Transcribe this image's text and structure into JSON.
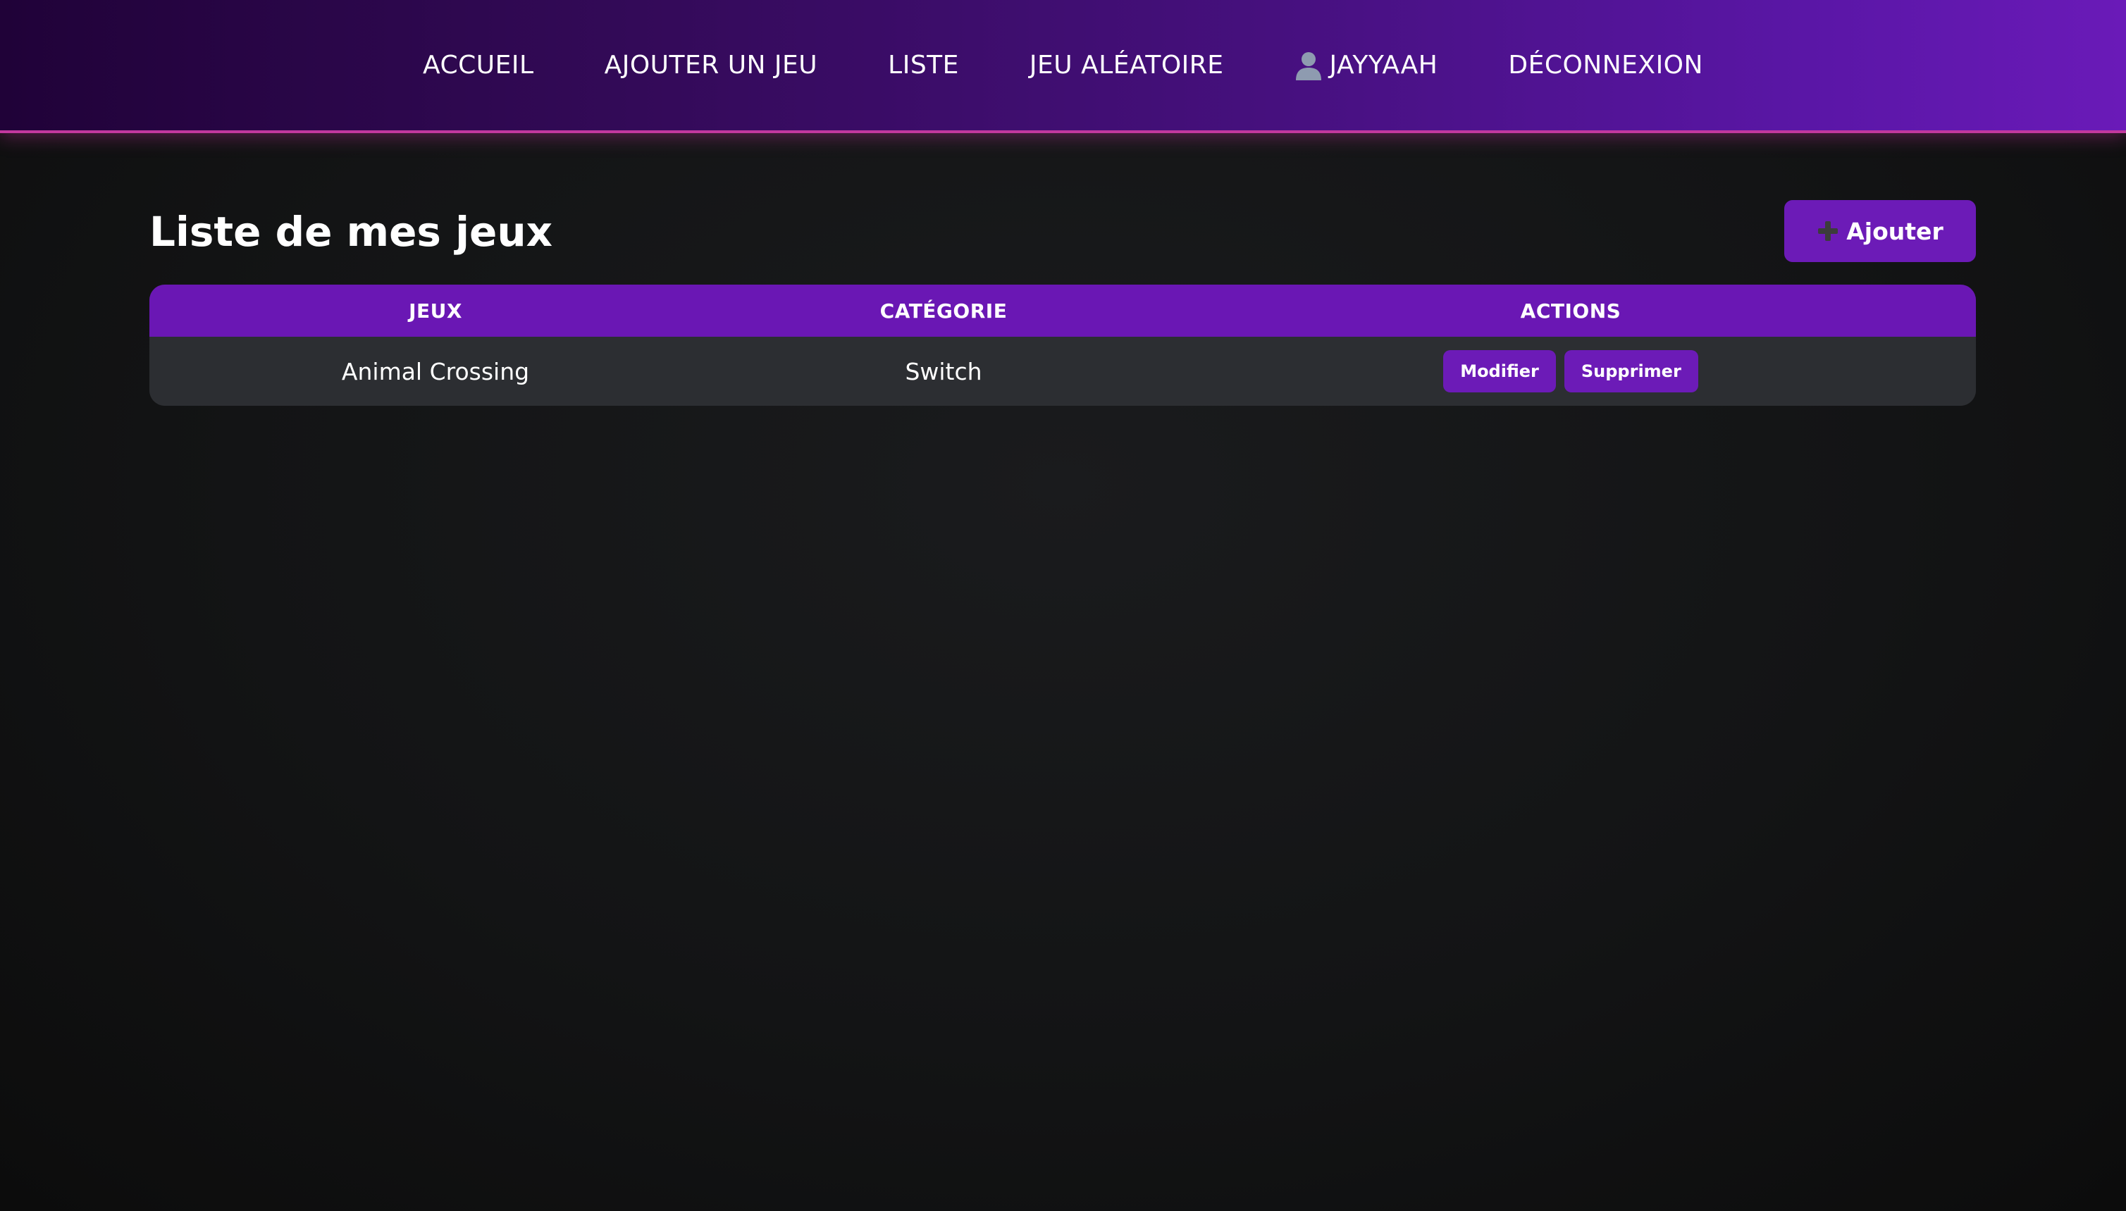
{
  "nav": {
    "items": [
      {
        "label": "ACCUEIL"
      },
      {
        "label": "AJOUTER UN JEU"
      },
      {
        "label": "LISTE"
      },
      {
        "label": "JEU ALÉATOIRE"
      },
      {
        "label": "JAYYAAH",
        "icon": "user-icon"
      },
      {
        "label": "DÉCONNEXION"
      }
    ]
  },
  "main": {
    "title": "Liste de mes jeux",
    "add_button": {
      "label": "Ajouter",
      "icon": "plus-icon"
    }
  },
  "table": {
    "headers": [
      "JEUX",
      "CATÉGORIE",
      "ACTIONS"
    ],
    "rows": [
      {
        "game": "Animal Crossing",
        "category": "Switch",
        "edit_label": "Modifier",
        "delete_label": "Supprimer"
      }
    ]
  },
  "colors": {
    "accent": "#6c1bb7",
    "nav_border": "#c2389e",
    "background": "#131415",
    "row_background": "#2c2e32"
  }
}
